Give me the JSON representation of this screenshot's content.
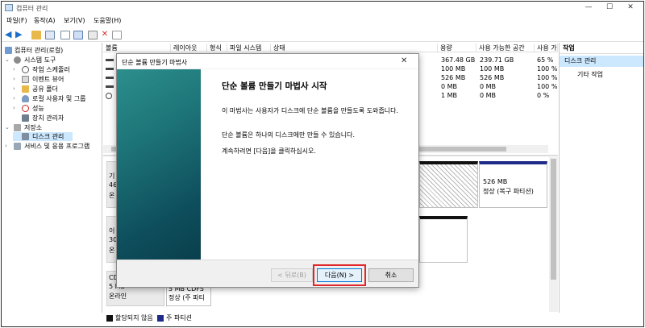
{
  "window": {
    "title": "컴퓨터 관리",
    "min": "—",
    "max": "☐",
    "close": "✕"
  },
  "menu": [
    "파일(F)",
    "동작(A)",
    "보기(V)",
    "도움말(H)"
  ],
  "tree": {
    "root": "컴퓨터 관리(로컬)",
    "system_tools": "시스템 도구",
    "task_scheduler": "작업 스케줄러",
    "event_viewer": "이벤트 뷰어",
    "shared_folders": "공유 폴더",
    "local_users": "로컬 사용자 및 그룹",
    "performance": "성능",
    "device_manager": "장치 관리자",
    "storage": "저장소",
    "disk_management": "디스크 관리",
    "services": "서비스 및 응용 프로그램"
  },
  "columns": {
    "volume": "볼륨",
    "layout": "레이아웃",
    "type": "형식",
    "fs": "파일 시스템",
    "status": "상태",
    "capacity": "용량",
    "free": "사용 가능한 공간",
    "pct": "사용 가"
  },
  "volumes": [
    {
      "capacity": "367.48 GB",
      "free": "239.71 GB",
      "pct": "65 %"
    },
    {
      "capacity": "100 MB",
      "free": "100 MB",
      "pct": "100 %"
    },
    {
      "capacity": "526 MB",
      "free": "526 MB",
      "pct": "100 %"
    },
    {
      "capacity": "0 MB",
      "free": "0 MB",
      "pct": "100 %"
    },
    {
      "capacity": "1 MB",
      "free": "0 MB",
      "pct": "0 %"
    }
  ],
  "actions": {
    "header": "작업",
    "disk_management": "디스크 관리",
    "more": "기타 작업"
  },
  "disks": {
    "d0_a": "기",
    "d0_b": "46",
    "d0_c": "온",
    "d1_a": "이",
    "d1_b": "30",
    "d1_c": "온",
    "cd_a": "CD",
    "cd_b": "5 MB",
    "cd_c": "온라인",
    "cd_part_a": "5 MB CDFS",
    "cd_part_b": "정상 (주 파티",
    "recovery_a": "526 MB",
    "recovery_b": "정상 (복구 파티션)"
  },
  "legend": {
    "unallocated": "할당되지 않음",
    "primary": "주 파티션"
  },
  "dialog": {
    "title": "단순 볼륨 만들기 마법사",
    "heading": "단순 볼륨 만들기 마법사 시작",
    "p1": "이 마법사는 사용자가 디스크에 단순 볼륨을 만들도록 도와줍니다.",
    "p2": "단순 볼륨은 하나의 디스크에만 만들 수 있습니다.",
    "p3": "계속하려면 [다음]을 클릭하십시오.",
    "back": "< 뒤로(B)",
    "next": "다음(N) >",
    "cancel": "취소",
    "close": "✕"
  },
  "colors": {
    "highlight": "#e0262a",
    "teal": "#1d7478",
    "selection": "#cce8ff"
  }
}
